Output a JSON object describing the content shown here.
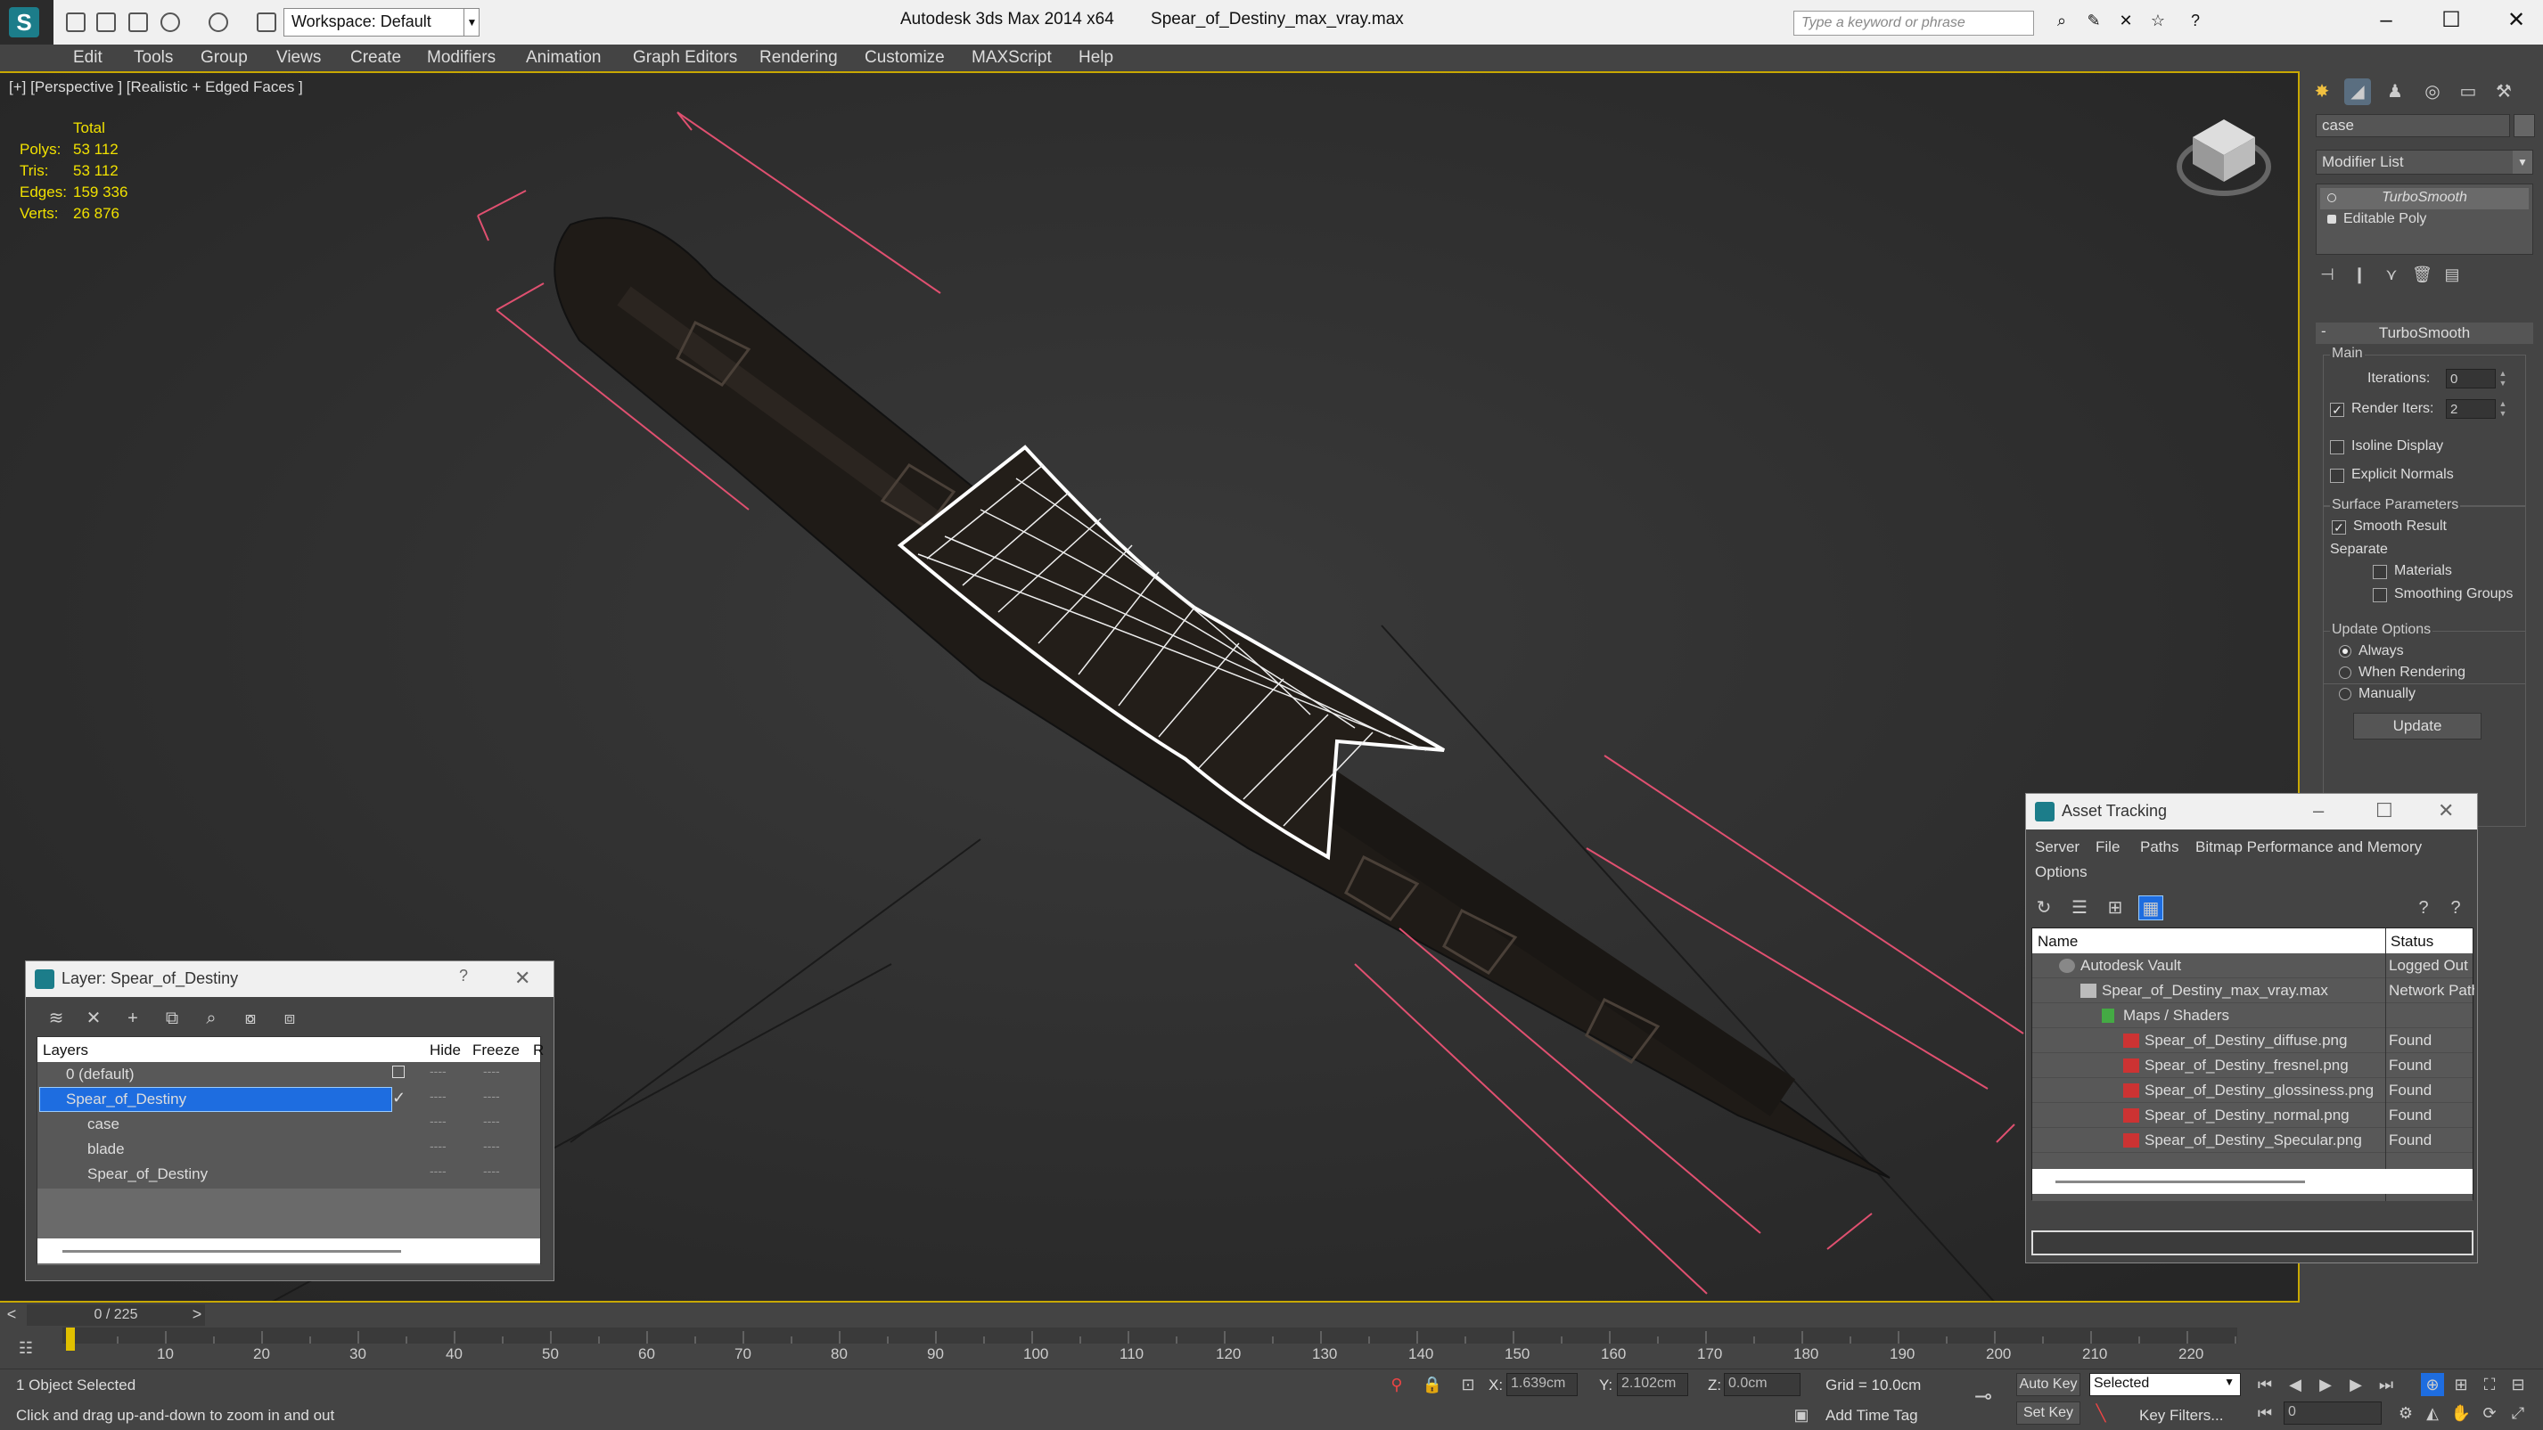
{
  "titlebar": {
    "app": "Autodesk 3ds Max  2014 x64",
    "file": "Spear_of_Destiny_max_vray.max",
    "workspace": "Workspace: Default",
    "search_placeholder": "Type a keyword or phrase"
  },
  "menu": [
    "Edit",
    "Tools",
    "Group",
    "Views",
    "Create",
    "Modifiers",
    "Animation",
    "Graph Editors",
    "Rendering",
    "Customize",
    "MAXScript",
    "Help"
  ],
  "viewport": {
    "label": "[+] [Perspective ] [Realistic + Edged Faces ]",
    "stats": {
      "header": "Total",
      "rows": [
        {
          "k": "Polys:",
          "v": "53 112"
        },
        {
          "k": "Tris:",
          "v": "53 112"
        },
        {
          "k": "Edges:",
          "v": "159 336"
        },
        {
          "k": "Verts:",
          "v": "26 876"
        }
      ]
    }
  },
  "command_panel": {
    "object_name": "case",
    "modifier_list": "Modifier List",
    "stack": [
      "TurboSmooth",
      "Editable Poly"
    ],
    "rollout_title": "TurboSmooth",
    "main_label": "Main",
    "iterations_label": "Iterations:",
    "iterations_value": "0",
    "render_iters_label": "Render Iters:",
    "render_iters_value": "2",
    "isoline_label": "Isoline Display",
    "explicit_label": "Explicit Normals",
    "surface_label": "Surface Parameters",
    "smooth_result_label": "Smooth Result",
    "separate_label": "Separate",
    "materials_label": "Materials",
    "smoothing_groups_label": "Smoothing Groups",
    "update_options_label": "Update Options",
    "always_label": "Always",
    "when_rendering_label": "When Rendering",
    "manually_label": "Manually",
    "update_button": "Update"
  },
  "layer_dialog": {
    "title": "Layer: Spear_of_Destiny",
    "help": "?",
    "col_layers": "Layers",
    "col_hide": "Hide",
    "col_freeze": "Freeze",
    "col_r": "R",
    "rows": [
      "0 (default)",
      "Spear_of_Destiny",
      "case",
      "blade",
      "Spear_of_Destiny"
    ],
    "dash": "----"
  },
  "asset_tracking": {
    "title": "Asset Tracking",
    "menu": [
      "Server",
      "File",
      "Paths",
      "Bitmap Performance and Memory",
      "Options"
    ],
    "col_name": "Name",
    "col_status": "Status",
    "rows": [
      {
        "name": "Autodesk Vault",
        "status": "Logged Out"
      },
      {
        "name": "Spear_of_Destiny_max_vray.max",
        "status": "Network Path"
      },
      {
        "name": "Maps / Shaders",
        "status": ""
      },
      {
        "name": "Spear_of_Destiny_diffuse.png",
        "status": "Found"
      },
      {
        "name": "Spear_of_Destiny_fresnel.png",
        "status": "Found"
      },
      {
        "name": "Spear_of_Destiny_glossiness.png",
        "status": "Found"
      },
      {
        "name": "Spear_of_Destiny_normal.png",
        "status": "Found"
      },
      {
        "name": "Spear_of_Destiny_Specular.png",
        "status": "Found"
      }
    ]
  },
  "timeline": {
    "frame": "0 / 225",
    "ticks": [
      "10",
      "20",
      "30",
      "40",
      "50",
      "60",
      "70",
      "80",
      "90",
      "100",
      "110",
      "120",
      "130",
      "140",
      "150",
      "160",
      "170",
      "180",
      "190",
      "200",
      "210",
      "220"
    ]
  },
  "status": {
    "selected": "1 Object Selected",
    "prompt": "Click and drag up-and-down to zoom in and out",
    "x_label": "X:",
    "x_value": "1.639cm",
    "y_label": "Y:",
    "y_value": "2.102cm",
    "z_label": "Z:",
    "z_value": "0.0cm",
    "grid": "Grid = 10.0cm",
    "add_time_tag": "Add Time Tag",
    "auto_key": "Auto Key",
    "set_key": "Set Key",
    "selected_option": "Selected",
    "key_filters": "Key Filters...",
    "frame_value": "0"
  }
}
